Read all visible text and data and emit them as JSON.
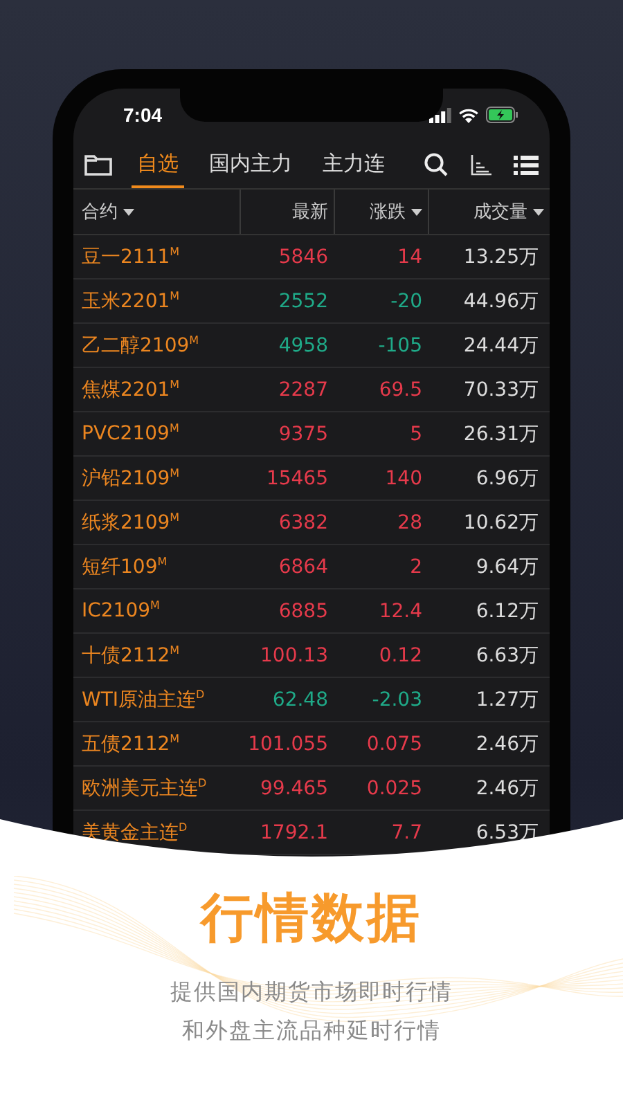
{
  "status_bar": {
    "time": "7:04"
  },
  "tabs": [
    {
      "label": "自选",
      "selected": true
    },
    {
      "label": "国内主力",
      "selected": false
    },
    {
      "label": "主力连",
      "selected": false
    }
  ],
  "table": {
    "columns": [
      {
        "label": "合约",
        "sortable": true
      },
      {
        "label": "最新",
        "sortable": false
      },
      {
        "label": "涨跌",
        "sortable": true
      },
      {
        "label": "成交量",
        "sortable": true
      }
    ],
    "rows": [
      {
        "name": "豆一2111$^{M}$",
        "latest": "5846",
        "change": "14",
        "volume": "13.25万",
        "color": "#e63a4b"
      },
      {
        "name": "玉米2201$^{M}$",
        "latest": "2552",
        "change": "-20",
        "volume": "44.96万",
        "color": "#1faa88"
      },
      {
        "name": "乙二醇2109$^{M}$",
        "latest": "4958",
        "change": "-105",
        "volume": "24.44万",
        "color": "#1faa88"
      },
      {
        "name": "焦煤2201$^{M}$",
        "latest": "2287",
        "change": "69.5",
        "volume": "70.33万",
        "color": "#e63a4b"
      },
      {
        "name": "PVC2109$^{M}$",
        "latest": "9375",
        "change": "5",
        "volume": "26.31万",
        "color": "#e63a4b"
      },
      {
        "name": "沪铅2109$^{M}$",
        "latest": "15465",
        "change": "140",
        "volume": "6.96万",
        "color": "#e63a4b"
      },
      {
        "name": "纸浆2109$^{M}$",
        "latest": "6382",
        "change": "28",
        "volume": "10.62万",
        "color": "#e63a4b"
      },
      {
        "name": "短纤109$^{M}$",
        "latest": "6864",
        "change": "2",
        "volume": "9.64万",
        "color": "#e63a4b"
      },
      {
        "name": "IC2109$^{M}$",
        "latest": "6885",
        "change": "12.4",
        "volume": "6.12万",
        "color": "#e63a4b"
      },
      {
        "name": "十债2112$^{M}$",
        "latest": "100.13",
        "change": "0.12",
        "volume": "6.63万",
        "color": "#e63a4b"
      },
      {
        "name": "WTI原油主连$^{D}$",
        "latest": "62.48",
        "change": "-2.03",
        "volume": "1.27万",
        "color": "#1faa88"
      },
      {
        "name": "五债2112$^{M}$",
        "latest": "101.055",
        "change": "0.075",
        "volume": "2.46万",
        "color": "#e63a4b"
      },
      {
        "name": "欧洲美元主连$^{D}$",
        "latest": "99.465",
        "change": "0.025",
        "volume": "2.46万",
        "color": "#e63a4b"
      },
      {
        "name": "美黄金主连$^{D}$",
        "latest": "1792.1",
        "change": "7.7",
        "volume": "6.53万",
        "color": "#e63a4b"
      }
    ]
  },
  "promo": {
    "title": "行情数据",
    "lines": [
      "提供国内期货市场即时行情",
      "和外盘主流品种延时行情"
    ]
  }
}
